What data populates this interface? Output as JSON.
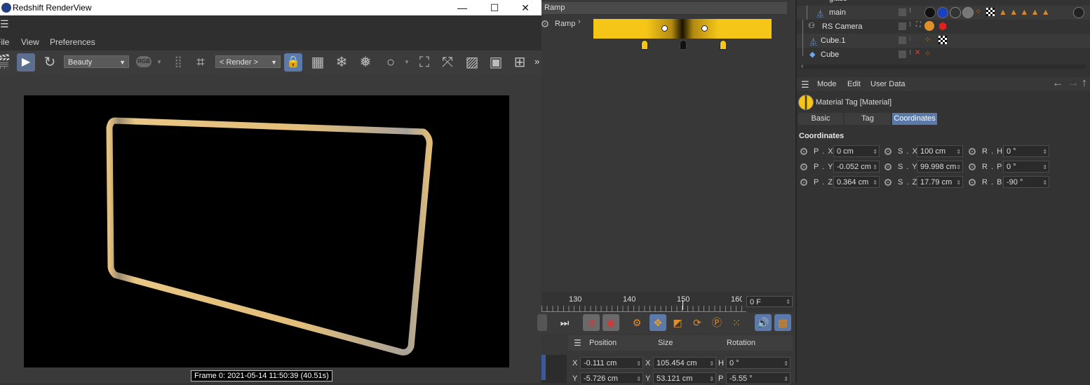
{
  "render_view": {
    "title": "Redshift RenderView",
    "menu": [
      "File",
      "View",
      "Preferences"
    ],
    "aov_select": "Beauty",
    "rgb_button": "RGB",
    "render_select": "< Render >",
    "more": "»",
    "frame_info": "Frame  0:  2021-05-14  11:50:39  (40.51s)"
  },
  "ramp": {
    "header": "Ramp",
    "label": "Ramp",
    "colors": {
      "yellow": "#f5c518",
      "dark": "#1a1400"
    }
  },
  "timeline": {
    "ticks": [
      "130",
      "140",
      "150",
      "160"
    ],
    "current_frame": "0 F"
  },
  "coordinates": {
    "headers": [
      "Position",
      "Size",
      "Rotation"
    ],
    "rows": [
      {
        "axis": "X",
        "pos": "-0.111 cm",
        "size_axis": "X",
        "size": "105.454 cm",
        "rot_axis": "H",
        "rot": "0 °"
      },
      {
        "axis": "Y",
        "pos": "-5.726 cm",
        "size_axis": "Y",
        "size": "53.121 cm",
        "rot_axis": "P",
        "rot": "-5.55 °"
      }
    ]
  },
  "object_manager": {
    "objects": [
      "glass",
      "main",
      "RS Camera",
      "Cube.1",
      "Cube"
    ]
  },
  "attributes": {
    "menu": [
      "Mode",
      "Edit",
      "User Data"
    ],
    "object_title": "Material Tag [Material]",
    "tabs": [
      "Basic",
      "Tag",
      "Coordinates"
    ],
    "section": "Coordinates",
    "fields": [
      {
        "label": "P . X",
        "value": "0 cm"
      },
      {
        "label": "P . Y",
        "value": "-0.052 cm"
      },
      {
        "label": "P . Z",
        "value": "0.364 cm"
      },
      {
        "label": "S . X",
        "value": "100 cm"
      },
      {
        "label": "S . Y",
        "value": "99.998 cm"
      },
      {
        "label": "S . Z",
        "value": "17.79 cm"
      },
      {
        "label": "R . H",
        "value": "0 °"
      },
      {
        "label": "R . P",
        "value": "0 °"
      },
      {
        "label": "R . B",
        "value": "-90 °"
      }
    ]
  },
  "colors": {
    "accent": "#5b7aa9",
    "gold": "#e8c27a",
    "orange": "#e0902a"
  }
}
